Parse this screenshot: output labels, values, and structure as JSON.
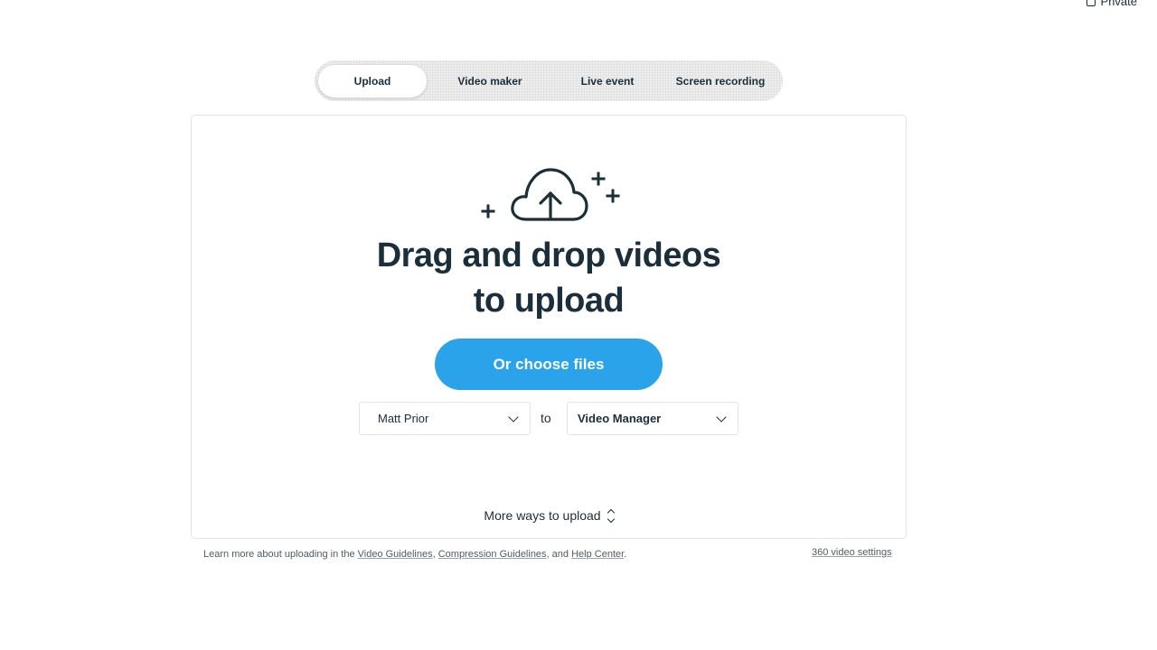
{
  "privacy": {
    "label": "Private"
  },
  "tabs": [
    {
      "label": "Upload",
      "active": true
    },
    {
      "label": "Video maker",
      "active": false
    },
    {
      "label": "Live event",
      "active": false
    },
    {
      "label": "Screen recording",
      "active": false
    }
  ],
  "dropzone": {
    "headline_line1": "Drag and drop videos",
    "headline_line2": "to upload",
    "choose_button": "Or choose files",
    "owner_select": "Matt Prior",
    "to_label": "to",
    "destination_select": "Video Manager",
    "more_ways": "More ways to upload"
  },
  "footer": {
    "prefix": "Learn more about uploading in the ",
    "link1": "Video Guidelines",
    "sep1": ", ",
    "link2": "Compression Guidelines",
    "sep2": ", and ",
    "link3": "Help Center",
    "suffix": ".",
    "settings_link": "360 video settings"
  },
  "colors": {
    "accent": "#2ba3ea",
    "text": "#1a2e3b",
    "border": "#e1e4e6"
  }
}
